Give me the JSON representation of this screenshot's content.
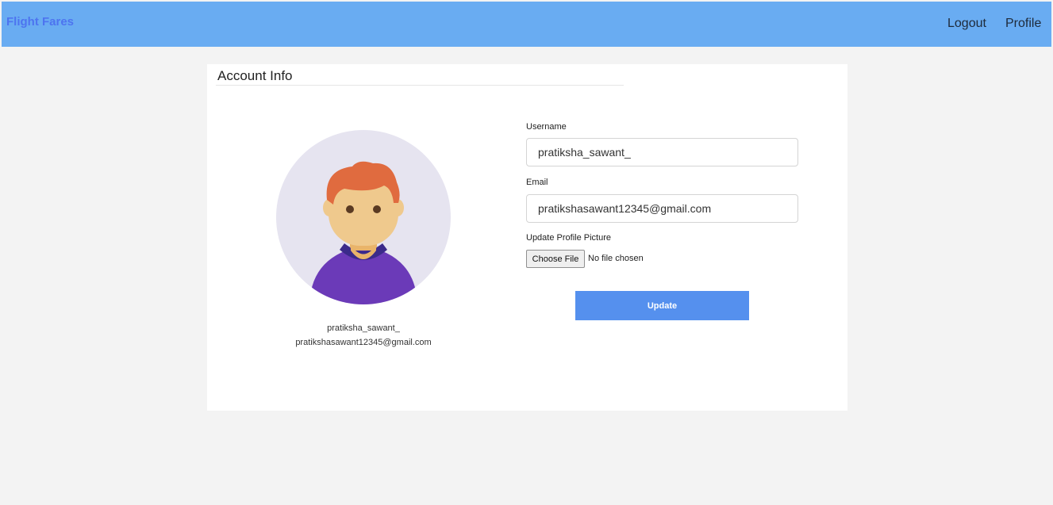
{
  "nav": {
    "brand": "Flight Fares",
    "logout": "Logout",
    "profile": "Profile"
  },
  "account": {
    "title": "Account Info",
    "display_name": "pratiksha_sawant_",
    "display_email": "pratikshasawant12345@gmail.com"
  },
  "form": {
    "username_label": "Username",
    "username_value": "pratiksha_sawant_",
    "email_label": "Email",
    "email_value": "pratikshasawant12345@gmail.com",
    "picture_label": "Update Profile Picture",
    "choose_file": "Choose File",
    "file_status": "No file chosen",
    "update_label": "Update"
  },
  "colors": {
    "header_bg": "#69acf2",
    "brand": "#4d74f0",
    "button": "#5590ee",
    "page_bg": "#f3f3f3"
  },
  "icons": {
    "avatar": "user-avatar-illustration"
  }
}
